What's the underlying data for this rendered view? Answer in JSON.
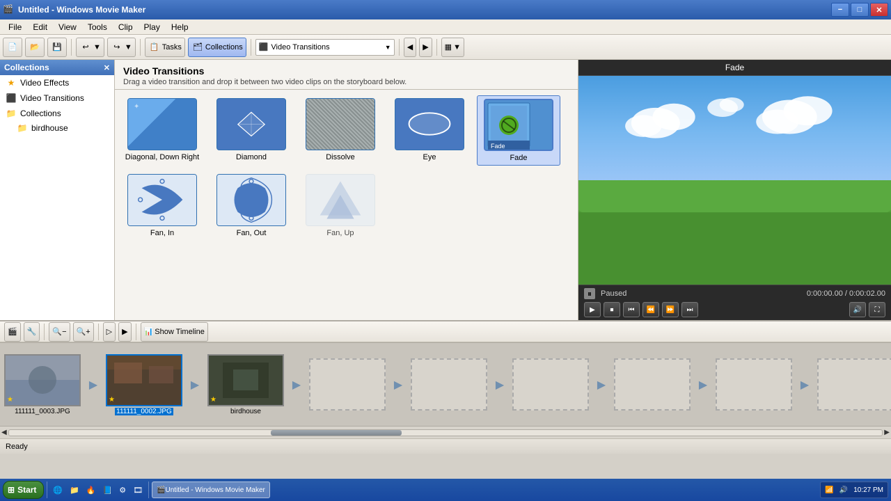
{
  "window": {
    "title": "Untitled - Windows Movie Maker",
    "state": "normal"
  },
  "titlebar": {
    "icon": "🎬",
    "title": "Untitled - Windows Movie Maker",
    "minimize": "−",
    "maximize": "□",
    "close": "✕"
  },
  "menubar": {
    "items": [
      "File",
      "Edit",
      "View",
      "Tools",
      "Clip",
      "Play",
      "Help"
    ]
  },
  "toolbar": {
    "new_label": "",
    "open_label": "",
    "save_label": "",
    "undo_label": "",
    "redo_label": "",
    "tasks_label": "Tasks",
    "collections_label": "Collections",
    "dropdown_label": "Video Transitions"
  },
  "sidebar": {
    "title": "Collections",
    "items": [
      {
        "id": "video-effects",
        "label": "Video Effects",
        "icon": "★"
      },
      {
        "id": "video-transitions",
        "label": "Video Transitions",
        "icon": "⬛"
      },
      {
        "id": "collections",
        "label": "Collections",
        "icon": "📁"
      },
      {
        "id": "birdhouse",
        "label": "birdhouse",
        "icon": "📁",
        "sub": true
      }
    ]
  },
  "content": {
    "title": "Video Transitions",
    "description": "Drag a video transition and drop it between two video clips on the storyboard below.",
    "transitions": [
      {
        "id": "diagonal-down-right",
        "label": "Diagonal, Down Right",
        "type": "diagonal"
      },
      {
        "id": "diamond",
        "label": "Diamond",
        "type": "diamond"
      },
      {
        "id": "dissolve",
        "label": "Dissolve",
        "type": "dissolve"
      },
      {
        "id": "eye",
        "label": "Eye",
        "type": "eye"
      },
      {
        "id": "fade",
        "label": "Fade",
        "type": "fade",
        "selected": true
      },
      {
        "id": "fan-in",
        "label": "Fan, In",
        "type": "fanin"
      },
      {
        "id": "fan-out",
        "label": "Fan, Out",
        "type": "fanout"
      },
      {
        "id": "fan-up",
        "label": "Fan, Up",
        "type": "fanup"
      }
    ]
  },
  "preview": {
    "title": "Fade",
    "status": "Paused",
    "time_current": "0:00:00.00",
    "time_total": "0:00:02.00",
    "time_display": "0:00:00.00 / 0:00:02.00"
  },
  "storyboard": {
    "show_timeline_label": "Show Timeline",
    "clips": [
      {
        "id": "clip1",
        "label": "111111_0003.JPG",
        "bg": "clip-bg-1",
        "selected": false
      },
      {
        "id": "clip2",
        "label": "111111_0002.JPG",
        "bg": "clip-bg-2",
        "selected": true
      },
      {
        "id": "clip3",
        "label": "birdhouse",
        "bg": "clip-bg-3",
        "selected": false
      }
    ]
  },
  "statusbar": {
    "text": "Ready"
  },
  "taskbar": {
    "start_label": "Start",
    "active_window": "Untitled - Windows Movie Maker",
    "time": "10:27 PM",
    "icons": [
      "🖥",
      "📁",
      "🔥",
      "📘",
      "⚙",
      "🎬"
    ]
  }
}
